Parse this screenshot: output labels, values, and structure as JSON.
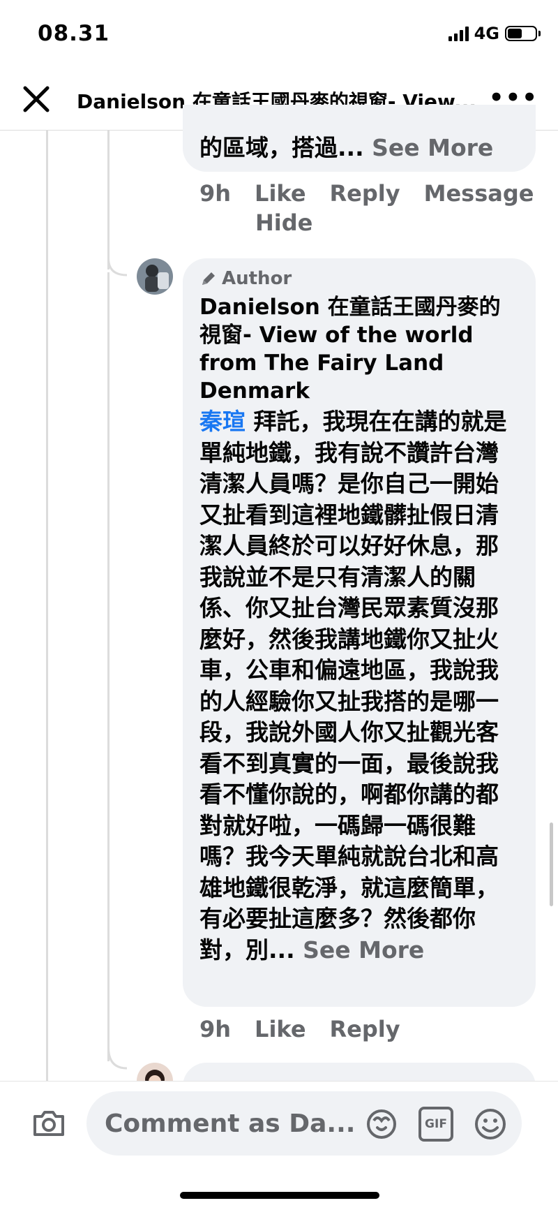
{
  "status_bar": {
    "time": "08.31",
    "network": "4G",
    "battery_level": 0.55
  },
  "header": {
    "title": "Danielson 在童話王國丹麥的視窗- View..."
  },
  "comment_top": {
    "text_end": "的區域，搭過...",
    "see_more": "See More",
    "actions": {
      "time": "9h",
      "like": "Like",
      "reply": "Reply",
      "message": "Message",
      "hide": "Hide"
    }
  },
  "comment_author": {
    "badge": "Author",
    "name": "Danielson 在童話王國丹麥的視窗- View of the world from The Fairy Land Denmark",
    "mention": "秦瑄",
    "body": " 拜託，我現在在講的就是單純地鐵，我有說不讚許台灣清潔人員嗎？是你自己一開始又扯看到這裡地鐵髒扯假日清潔人員終於可以好好休息，那我說並不是只有清潔人的關係、你又扯台灣民眾素質沒那麼好，然後我講地鐵你又扯火車，公車和偏遠地區，我說我的人經驗你又扯我搭的是哪一段，我說外國人你又扯觀光客看不到真實的一面，最後說我看不懂你說的，啊都你講的都對就好啦，一碼歸一碼很難嗎？我今天單純就說台北和高雄地鐵很乾淨，就這麼簡單，有必要扯這麼多？然後都你對，別...",
    "see_more": "See More",
    "actions": {
      "time": "9h",
      "like": "Like",
      "reply": "Reply"
    }
  },
  "composer": {
    "placeholder": "Comment as Da...",
    "gif_label": "GIF"
  }
}
